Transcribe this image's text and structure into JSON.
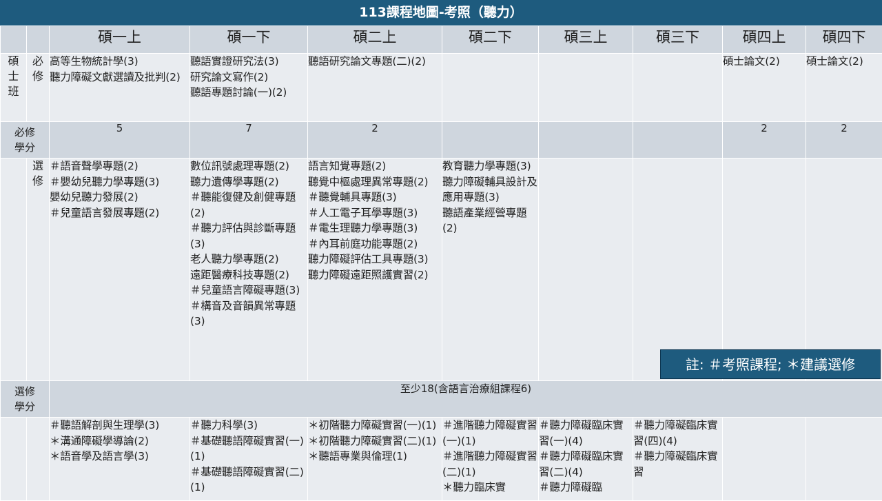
{
  "title": "113課程地圖-考照（聽力）",
  "semesters": [
    "碩一上",
    "碩一下",
    "碩二上",
    "碩二下",
    "碩三上",
    "碩三下",
    "碩四上",
    "碩四下"
  ],
  "labels": {
    "program": "碩士班",
    "required": "必修",
    "required_credits": "必修學分",
    "elective": "選修",
    "elective_credits": "選修學分"
  },
  "required_courses": [
    [
      "高等生物統計學(3)",
      "聽力障礙文獻選讀及批判(2)"
    ],
    [
      "聽語實證研究法(3)",
      "研究論文寫作(2)",
      "聽語專題討論(一)(2)"
    ],
    [
      "聽語研究論文專題(二)(2)"
    ],
    [],
    [],
    [],
    [
      "碩士論文(2)"
    ],
    [
      "碩士論文(2)"
    ]
  ],
  "required_credits": [
    "5",
    "7",
    "2",
    "",
    "",
    "",
    "2",
    "2"
  ],
  "elective_courses": [
    [
      "＃語音聲學專題(2)",
      "＃嬰幼兒聽力學專題(3)",
      "嬰幼兒聽力發展(2)",
      "＃兒童語言發展專題(2)"
    ],
    [
      "數位訊號處理專題(2)",
      "聽力遺傳學專題(2)",
      "＃聽能復健及創健專題(2)",
      "＃聽力評估與診斷專題(3)",
      "老人聽力學專題(2)",
      "遠距醫療科技專題(2)",
      "＃兒童語言障礙專題(3)",
      "＃構音及音韻異常專題(3)"
    ],
    [
      "語言知覺專題(2)",
      "聽覺中樞處理異常專題(2)",
      "＃聽覺輔具專題(3)",
      "＃人工電子耳學專題(3)",
      "＃電生理聽力學專題(3)",
      "＃內耳前庭功能專題(2)",
      "聽力障礙評估工具專題(3)",
      "聽力障礙遠距照護實習(2)"
    ],
    [
      "教育聽力學專題(3)",
      "聽力障礙輔具設計及應用專題(3)",
      "聽語產業經營專題(2)"
    ],
    [],
    [],
    [],
    []
  ],
  "elective_credits_text": "至少18(含語言治療組課程6)",
  "practicum_courses": [
    [
      "＃聽語解剖與生理學(3)",
      "＊溝通障礙學導論(2)",
      "＊語音學及語言學(3)"
    ],
    [
      "＃聽力科學(3)",
      "＃基礎聽語障礙實習(一)(1)",
      "＃基礎聽語障礙實習(二)(1)"
    ],
    [
      "＊初階聽力障礙實習(一)(1)",
      "＊初階聽力障礙實習(二)(1)",
      "＊聽語專業與倫理(1)"
    ],
    [
      "＃進階聽力障礙實習(一)(1)",
      "＃進階聽力障礙實習(二)(1)",
      "＊聽力臨床實"
    ],
    [
      "＃聽力障礙臨床實習(一)(4)",
      "＃聽力障礙臨床實習(二)(4)",
      "＃聽力障礙臨"
    ],
    [
      "＃聽力障礙臨床實習(四)(4)",
      "＃聽力障礙臨床實習"
    ],
    [],
    []
  ],
  "note": "註: ＃考照課程; ＊建議選修"
}
